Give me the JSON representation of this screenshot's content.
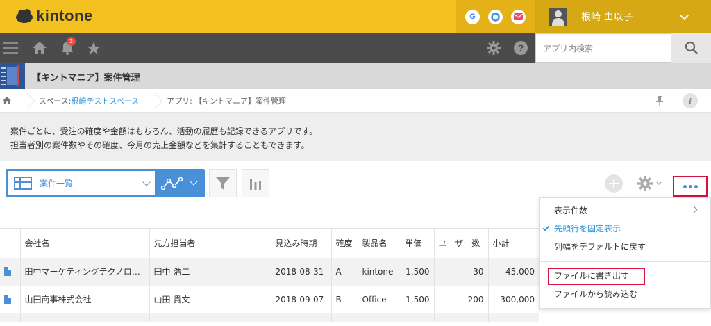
{
  "header": {
    "brand": "kintone",
    "user_name": "根崎 由以子",
    "apps": [
      {
        "letter": "G",
        "color": "#4285f4",
        "icon": "google-icon"
      },
      {
        "letter": "",
        "color": "#3498db",
        "icon": "circle-app-icon"
      },
      {
        "letter": "",
        "color": "#e74c6c",
        "icon": "mail-icon"
      }
    ]
  },
  "nav": {
    "notification_count": "3",
    "search_placeholder": "アプリ内検索"
  },
  "app": {
    "title": "【キントマニア】案件管理"
  },
  "breadcrumb": {
    "space_label": "スペース: ",
    "space_link": "根崎テストスペース",
    "app_label": "アプリ: 【キントマニア】案件管理"
  },
  "description": {
    "line1": "案件ごとに、受注の確度や金額はもちろん、活動の履歴も記録できるアプリです。",
    "line2": "担当者別の案件数やその確度、今月の売上金額などを集計することもできます。"
  },
  "toolbar": {
    "view_label": "案件一覧"
  },
  "table": {
    "headers": [
      "会社名",
      "先方担当者",
      "見込み時期",
      "確度",
      "製品名",
      "単価",
      "ユーザー数",
      "小計"
    ],
    "rows": [
      [
        "田中マーケティングテクノロ…",
        "田中 浩二",
        "2018-08-31",
        "A",
        "kintone",
        "1,500",
        "30",
        "45,000"
      ],
      [
        "山田商事株式会社",
        "山田 貴文",
        "2018-09-07",
        "B",
        "Office",
        "1,500",
        "200",
        "300,000"
      ]
    ]
  },
  "menu": {
    "items": [
      {
        "label": "表示件数"
      },
      {
        "label": "先頭行を固定表示"
      },
      {
        "label": "列幅をデフォルトに戻す"
      },
      {
        "label": "ファイルに書き出す"
      },
      {
        "label": "ファイルから読み込む"
      }
    ]
  },
  "colors": {
    "header_yellow": "#f2c11f",
    "nav_dark": "#4b4b4b",
    "accent_blue": "#4a90d9",
    "highlight_red": "#d51140"
  }
}
